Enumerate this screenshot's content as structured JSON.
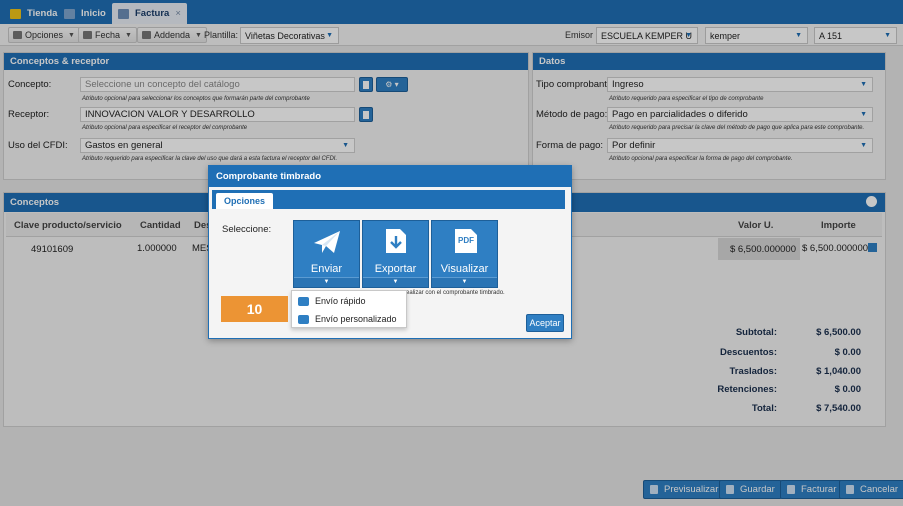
{
  "tabs": [
    {
      "label": "Tienda",
      "icon": "store-icon"
    },
    {
      "label": "Inicio",
      "icon": "home-icon"
    },
    {
      "label": "Factura",
      "icon": "invoice-icon",
      "close": "×"
    }
  ],
  "toolbar": {
    "opciones": "Opciones",
    "fecha": "Fecha",
    "addenda": "Addenda",
    "plantilla_label": "Plantilla:",
    "plantilla_value": "Viñetas Decorativas",
    "emisor_label": "Emisor",
    "emisor_value": "ESCUELA KEMPER U",
    "user_value": "kemper",
    "serie_value": "A 151"
  },
  "conceptos_receptor": {
    "title": "Conceptos & receptor",
    "concepto_label": "Concepto:",
    "concepto_placeholder": "Seleccione un concepto del catálogo",
    "concepto_hint": "Atributo opcional para seleccionar los conceptos que formarán parte del comprobante",
    "receptor_label": "Receptor:",
    "receptor_value": "INNOVACION VALOR Y DESARROLLO",
    "receptor_hint": "Atributo opcional para especificar el receptor del comprobante",
    "uso_label": "Uso del CFDI:",
    "uso_value": "Gastos en general",
    "uso_hint": "Atributo requerido para especificar la clave del uso que dará a esta factura el receptor del CFDI."
  },
  "datos": {
    "title": "Datos",
    "tipo_label": "Tipo comprobante:",
    "tipo_value": "Ingreso",
    "tipo_hint": "Atributo requerido para especificar el tipo de comprobante",
    "metodo_label": "Método de pago:",
    "metodo_value": "Pago en parcialidades o diferido",
    "metodo_hint": "Atributo requerido para precisar la clave del método de pago que aplica para este comprobante.",
    "forma_label": "Forma de pago:",
    "forma_value": "Por definir",
    "forma_hint": "Atributo opcional para especificar la forma de pago del comprobante."
  },
  "conceptos": {
    "title": "Conceptos",
    "columns": [
      "Clave producto/servicio",
      "Cantidad",
      "Des",
      "Valor U.",
      "Importe"
    ],
    "row": {
      "clave": "49101609",
      "cantidad": "1.000000",
      "desc": "MES",
      "valor": "$ 6,500.000000",
      "importe": "$ 6,500.000000"
    }
  },
  "totals": [
    {
      "label": "Subtotal:",
      "value": "$ 6,500.00"
    },
    {
      "label": "Descuentos:",
      "value": "$ 0.00"
    },
    {
      "label": "Traslados:",
      "value": "$ 1,040.00"
    },
    {
      "label": "Retenciones:",
      "value": "$ 0.00"
    },
    {
      "label": "Total:",
      "value": "$ 7,540.00"
    }
  ],
  "bottom_buttons": [
    "Previsualizar",
    "Guardar",
    "Facturar",
    "Cancelar"
  ],
  "dialog": {
    "title": "Comprobante timbrado",
    "tab": "Opciones",
    "seleccione": "Seleccione:",
    "buttons": [
      "Enviar",
      "Exportar",
      "Visualizar"
    ],
    "pdf_label": "PDF",
    "hint_tail": "a realizar con el comprobante timbrado.",
    "aceptar": "Aceptar",
    "menu": [
      "Envío rápido",
      "Envío personalizado"
    ]
  },
  "callout": "10"
}
